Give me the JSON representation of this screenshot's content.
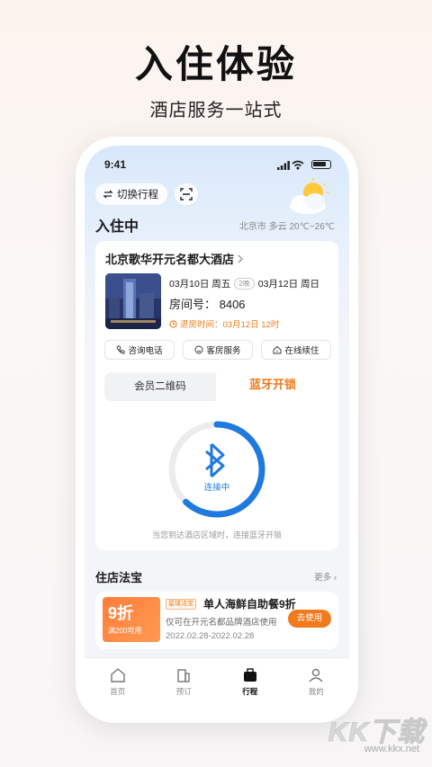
{
  "hero": {
    "title": "入住体验",
    "subtitle": "酒店服务一站式"
  },
  "status_bar": {
    "time": "9:41"
  },
  "top": {
    "switch_label": "切换行程",
    "section_title": "入住中",
    "weather": "北京市 多云 20℃~26℃"
  },
  "hotel": {
    "name": "北京歌华开元名都大酒店",
    "checkin_date": "03月10日 周五",
    "nights": "2晚",
    "checkout_date": "03月12日 周日",
    "room": "房间号： 8406",
    "checkout_time": "退房时间：03月12日 12时"
  },
  "actions": [
    {
      "label": "咨询电话",
      "icon": "phone-icon"
    },
    {
      "label": "客房服务",
      "icon": "service-icon"
    },
    {
      "label": "在线续住",
      "icon": "home-icon"
    }
  ],
  "tabs": {
    "qr": "会员二维码",
    "bluetooth": "蓝牙开锁"
  },
  "unlock": {
    "status": "连接中",
    "hint": "当您到达酒店区域时，连接蓝牙开锁",
    "progress": 0.62
  },
  "treasure": {
    "title": "住店法宝",
    "more": "更多",
    "coupon": {
      "discount": "9折",
      "condition": "满200可用",
      "tag": "星球法宝",
      "title": "单人海鲜自助餐9折",
      "desc": "仅可在开元名都品牌酒店使用",
      "date": "2022.02.28-2022.02.28",
      "button": "去使用"
    }
  },
  "nav": [
    {
      "label": "首页",
      "icon": "home-nav-icon"
    },
    {
      "label": "预订",
      "icon": "building-icon"
    },
    {
      "label": "行程",
      "icon": "briefcase-icon"
    },
    {
      "label": "我的",
      "icon": "user-icon"
    }
  ],
  "watermark": {
    "logo": "KK下载",
    "url": "www.kkx.net"
  },
  "colors": {
    "accent": "#f07a1d",
    "blue": "#1f7ae0"
  }
}
